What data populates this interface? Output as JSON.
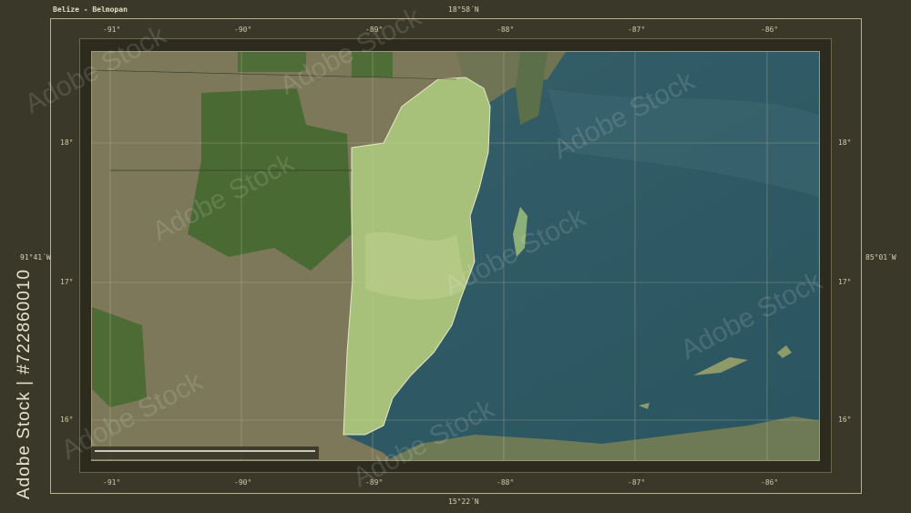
{
  "title": "Belize - Belmopan",
  "lat_top": "18°58´N",
  "lat_bottom": "15°22´N",
  "lon_left": "91°41´W",
  "lon_right": "85°01´W",
  "lon_ticks": [
    "-91°",
    "-90°",
    "-89°",
    "-88°",
    "-87°",
    "-86°"
  ],
  "lat_ticks": [
    "18°",
    "17°",
    "16°"
  ],
  "stock_id": "Adobe Stock | #722860010",
  "watermark": "Adobe Stock",
  "colors": {
    "sea": "#2e5a66",
    "belize_highlight": "#a8c27a",
    "land": "#7d7a5c",
    "forest": "#4b6a34",
    "frame": "#b7b08c"
  }
}
